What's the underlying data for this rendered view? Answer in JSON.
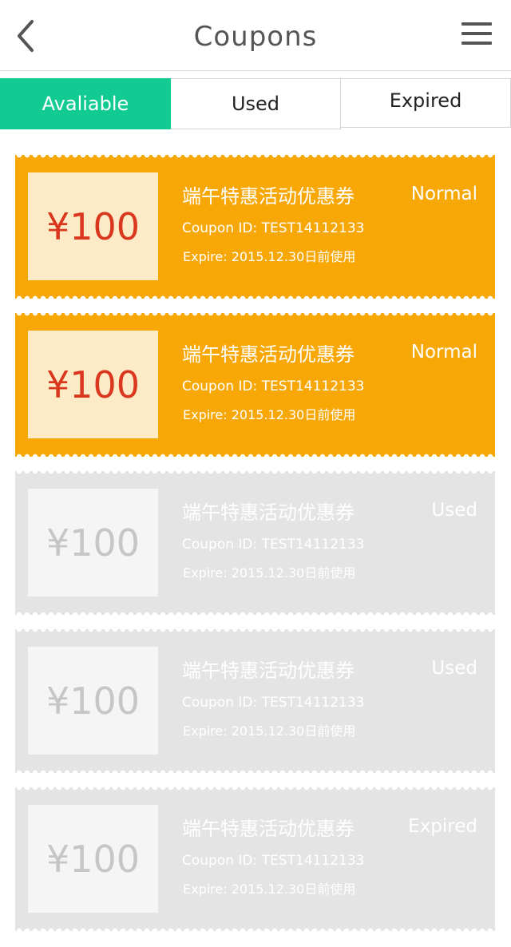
{
  "header": {
    "title": "Coupons",
    "back_icon": "chevron-left-icon",
    "menu_icon": "hamburger-menu-icon"
  },
  "tabs": [
    {
      "label": "Avaliable",
      "active": true
    },
    {
      "label": "Used",
      "active": false
    },
    {
      "label": "Expired",
      "active": false
    }
  ],
  "colors": {
    "accent": "#12cb92",
    "coupon_active": "#f7a807",
    "coupon_inactive": "#e4e4e4",
    "amount_text": "#d9381e"
  },
  "coupons": [
    {
      "amount": "¥100",
      "title": "端午特惠活动优惠券",
      "status": "Normal",
      "id_text": "Coupon ID: TEST14112133",
      "expire_text": "Expire: 2015.12.30日前使用",
      "style": "orange"
    },
    {
      "amount": "¥100",
      "title": "端午特惠活动优惠券",
      "status": "Normal",
      "id_text": "Coupon ID: TEST14112133",
      "expire_text": "Expire: 2015.12.30日前使用",
      "style": "orange"
    },
    {
      "amount": "¥100",
      "title": "端午特惠活动优惠券",
      "status": "Used",
      "id_text": "Coupon ID: TEST14112133",
      "expire_text": "Expire: 2015.12.30日前使用",
      "style": "gray"
    },
    {
      "amount": "¥100",
      "title": "端午特惠活动优惠券",
      "status": "Used",
      "id_text": "Coupon ID: TEST14112133",
      "expire_text": "Expire: 2015.12.30日前使用",
      "style": "gray"
    },
    {
      "amount": "¥100",
      "title": "端午特惠活动优惠券",
      "status": "Expired",
      "id_text": "Coupon ID: TEST14112133",
      "expire_text": "Expire: 2015.12.30日前使用",
      "style": "gray"
    }
  ]
}
